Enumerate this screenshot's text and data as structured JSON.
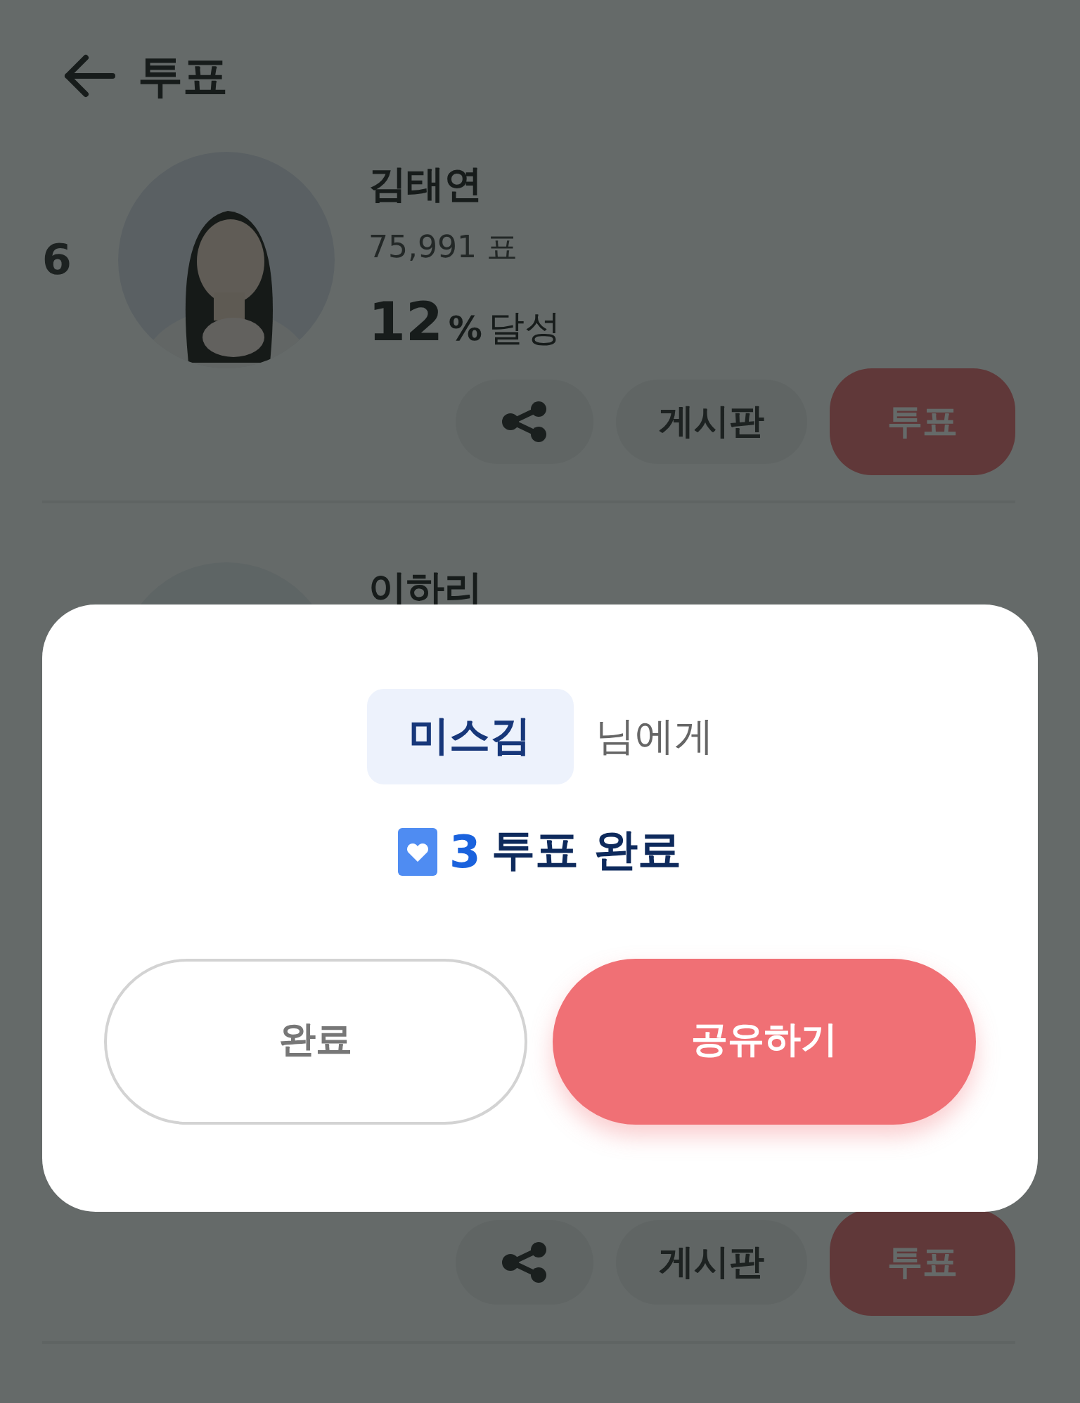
{
  "header": {
    "title": "투표"
  },
  "candidates": [
    {
      "rank": "6",
      "name": "김태연",
      "votes": "75,991 표",
      "percent": "12",
      "percent_unit": "%",
      "achieved_label": "달성",
      "board_button": "게시판",
      "vote_button": "투표"
    },
    {
      "name": "이하리",
      "board_button": "게시판",
      "vote_button": "투표"
    }
  ],
  "dialog": {
    "recipient": "미스김",
    "recipient_suffix": "님에게",
    "vote_count": "3",
    "result_text": "투표 완료",
    "buttons": [
      {
        "label": "완료",
        "kind": "outline"
      },
      {
        "label": "공유하기",
        "kind": "primary"
      }
    ]
  }
}
